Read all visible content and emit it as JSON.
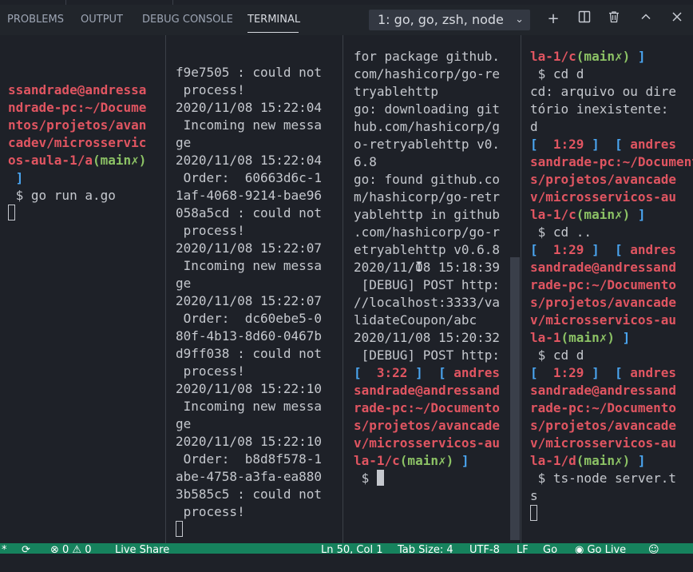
{
  "panel_tabs": [
    "PROBLEMS",
    "OUTPUT",
    "DEBUG CONSOLE",
    "TERMINAL"
  ],
  "terminal_selector": {
    "value": "1: go, go, zsh, node"
  },
  "toolbar_icons": [
    "plus-icon",
    "split-icon",
    "trash-icon",
    "chevron-up-icon",
    "close-icon"
  ],
  "panes": [
    {
      "lines": [
        [],
        [
          {
            "t": "ssandrade@andressa",
            "c": "red"
          }
        ],
        [
          {
            "t": "ndrade-pc:~/Docume",
            "c": "red"
          }
        ],
        [
          {
            "t": "ntos/projetos/avan",
            "c": "red"
          }
        ],
        [
          {
            "t": "cadev/microsservic",
            "c": "red"
          }
        ],
        [
          {
            "t": "os-aula-1/a",
            "c": "red"
          },
          {
            "t": "(main✗)",
            "c": "green"
          }
        ],
        [
          {
            "t": " ]",
            "c": "blue"
          }
        ],
        [
          {
            "t": " $ go run a.go",
            "c": ""
          }
        ],
        [
          {
            "t": "",
            "c": "cursor"
          }
        ]
      ]
    },
    {
      "lines": [
        [
          {
            "t": "f9e7505 : could not",
            "c": ""
          }
        ],
        [
          {
            "t": " process!",
            "c": ""
          }
        ],
        [
          {
            "t": "2020/11/08 15:22:04",
            "c": ""
          }
        ],
        [
          {
            "t": " Incoming new messa",
            "c": ""
          }
        ],
        [
          {
            "t": "ge",
            "c": ""
          }
        ],
        [
          {
            "t": "2020/11/08 15:22:04",
            "c": ""
          }
        ],
        [
          {
            "t": " Order:  60663d6c-1",
            "c": ""
          }
        ],
        [
          {
            "t": "1af-4068-9214-bae96",
            "c": ""
          }
        ],
        [
          {
            "t": "058a5cd : could not",
            "c": ""
          }
        ],
        [
          {
            "t": " process!",
            "c": ""
          }
        ],
        [
          {
            "t": "2020/11/08 15:22:07",
            "c": ""
          }
        ],
        [
          {
            "t": " Incoming new messa",
            "c": ""
          }
        ],
        [
          {
            "t": "ge",
            "c": ""
          }
        ],
        [
          {
            "t": "2020/11/08 15:22:07",
            "c": ""
          }
        ],
        [
          {
            "t": " Order:  dc60ebe5-0",
            "c": ""
          }
        ],
        [
          {
            "t": "80f-4b13-8d60-0467b",
            "c": ""
          }
        ],
        [
          {
            "t": "d9ff038 : could not",
            "c": ""
          }
        ],
        [
          {
            "t": " process!",
            "c": ""
          }
        ],
        [
          {
            "t": "2020/11/08 15:22:10",
            "c": ""
          }
        ],
        [
          {
            "t": " Incoming new messa",
            "c": ""
          }
        ],
        [
          {
            "t": "ge",
            "c": ""
          }
        ],
        [
          {
            "t": "2020/11/08 15:22:10",
            "c": ""
          }
        ],
        [
          {
            "t": " Order:  b8d8f578-1",
            "c": ""
          }
        ],
        [
          {
            "t": "abe-4758-a3fa-ea880",
            "c": ""
          }
        ],
        [
          {
            "t": "3b585c5 : could not",
            "c": ""
          }
        ],
        [
          {
            "t": " process!",
            "c": ""
          }
        ],
        [
          {
            "t": "",
            "c": "cursor"
          }
        ]
      ]
    },
    {
      "lines": [
        [
          {
            "t": "for package github.",
            "c": ""
          }
        ],
        [
          {
            "t": "com/hashicorp/go-re",
            "c": ""
          }
        ],
        [
          {
            "t": "tryablehttp",
            "c": ""
          }
        ],
        [
          {
            "t": "go: downloading git",
            "c": ""
          }
        ],
        [
          {
            "t": "hub.com/hashicorp/g",
            "c": ""
          }
        ],
        [
          {
            "t": "o-retryablehttp v0.",
            "c": ""
          }
        ],
        [
          {
            "t": "6.8",
            "c": ""
          }
        ],
        [
          {
            "t": "go: found github.co",
            "c": ""
          }
        ],
        [
          {
            "t": "m/hashicorp/go-retr",
            "c": ""
          }
        ],
        [
          {
            "t": "yablehttp in github",
            "c": ""
          }
        ],
        [
          {
            "t": ".com/hashicorp/go-r",
            "c": ""
          }
        ],
        [
          {
            "t": "etryablehttp v0.6.8",
            "c": ""
          }
        ],
        [
          {
            "t": "2020/11/08 15:18:39",
            "c": ""
          }
        ],
        [
          {
            "t": " [DEBUG] POST http:",
            "c": ""
          }
        ],
        [
          {
            "t": "//localhost:3333/va",
            "c": ""
          }
        ],
        [
          {
            "t": "lidateCoupon/abc",
            "c": ""
          }
        ],
        [
          {
            "t": "2020/11/08 15:20:32",
            "c": ""
          }
        ],
        [
          {
            "t": " [DEBUG] POST http:",
            "c": ""
          }
        ],
        [
          {
            "t": "[  ",
            "c": "blue"
          },
          {
            "t": "3:22",
            "c": "red"
          },
          {
            "t": " ]  [ ",
            "c": "blue"
          },
          {
            "t": "andres",
            "c": "red"
          }
        ],
        [
          {
            "t": "sandrade@andressand",
            "c": "red"
          }
        ],
        [
          {
            "t": "rade-pc:~/Documento",
            "c": "red"
          }
        ],
        [
          {
            "t": "s/projetos/avancade",
            "c": "red"
          }
        ],
        [
          {
            "t": "v/microsservicos-au",
            "c": "red"
          }
        ],
        [
          {
            "t": "la-1/c",
            "c": "red"
          },
          {
            "t": "(main✗)",
            "c": "green"
          },
          {
            "t": " ]",
            "c": "blue"
          }
        ],
        [
          {
            "t": " $ ",
            "c": ""
          },
          {
            "t": "",
            "c": "cursor-filled"
          }
        ]
      ]
    },
    {
      "lines": [
        [
          {
            "t": "la-1/c",
            "c": "red"
          },
          {
            "t": "(main✗)",
            "c": "green"
          },
          {
            "t": " ]",
            "c": "blue"
          }
        ],
        [
          {
            "t": " $ cd d",
            "c": ""
          }
        ],
        [
          {
            "t": "cd: arquivo ou dire",
            "c": ""
          }
        ],
        [
          {
            "t": "tório inexistente:",
            "c": ""
          }
        ],
        [
          {
            "t": "d",
            "c": ""
          }
        ],
        [
          {
            "t": "[  ",
            "c": "blue"
          },
          {
            "t": "1:29",
            "c": "red"
          },
          {
            "t": " ]  [ ",
            "c": "blue"
          },
          {
            "t": "andres",
            "c": "red"
          }
        ],
        [
          {
            "t": "sandrade-pc:~/Documento",
            "c": "red"
          }
        ],
        [
          {
            "t": "s/projetos/avancade",
            "c": "red"
          }
        ],
        [
          {
            "t": "v/microsservicos-au",
            "c": "red"
          }
        ],
        [
          {
            "t": "la-1/c",
            "c": "red"
          },
          {
            "t": "(main✗)",
            "c": "green"
          },
          {
            "t": " ]",
            "c": "blue"
          }
        ],
        [
          {
            "t": " $ cd ..",
            "c": ""
          }
        ],
        [
          {
            "t": "[  ",
            "c": "blue"
          },
          {
            "t": "1:29",
            "c": "red"
          },
          {
            "t": " ]  [ ",
            "c": "blue"
          },
          {
            "t": "andres",
            "c": "red"
          }
        ],
        [
          {
            "t": "sandrade@andressand",
            "c": "red"
          }
        ],
        [
          {
            "t": "rade-pc:~/Documento",
            "c": "red"
          }
        ],
        [
          {
            "t": "s/projetos/avancade",
            "c": "red"
          }
        ],
        [
          {
            "t": "v/microsservicos-au",
            "c": "red"
          }
        ],
        [
          {
            "t": "la-1",
            "c": "red"
          },
          {
            "t": "(main✗)",
            "c": "green"
          },
          {
            "t": " ]",
            "c": "blue"
          }
        ],
        [
          {
            "t": " $ cd d",
            "c": ""
          }
        ],
        [
          {
            "t": "[  ",
            "c": "blue"
          },
          {
            "t": "1:29",
            "c": "red"
          },
          {
            "t": " ]  [ ",
            "c": "blue"
          },
          {
            "t": "andres",
            "c": "red"
          }
        ],
        [
          {
            "t": "sandrade@andressand",
            "c": "red"
          }
        ],
        [
          {
            "t": "rade-pc:~/Documento",
            "c": "red"
          }
        ],
        [
          {
            "t": "s/projetos/avancade",
            "c": "red"
          }
        ],
        [
          {
            "t": "v/microsservicos-au",
            "c": "red"
          }
        ],
        [
          {
            "t": "la-1/d",
            "c": "red"
          },
          {
            "t": "(main✗)",
            "c": "green"
          },
          {
            "t": " ]",
            "c": "blue"
          }
        ],
        [
          {
            "t": " $ ts-node server.t",
            "c": ""
          }
        ],
        [
          {
            "t": "s",
            "c": ""
          }
        ],
        [
          {
            "t": "",
            "c": "cursor"
          }
        ]
      ]
    }
  ],
  "status_bar": {
    "items": [
      "*",
      "⟳",
      "⊗ 0 ⚠ 0",
      "Live Share",
      "Ln 50, Col 1",
      "Tab Size: 4",
      "UTF-8",
      "LF",
      "Go",
      "◉ Go Live",
      "☺"
    ]
  }
}
